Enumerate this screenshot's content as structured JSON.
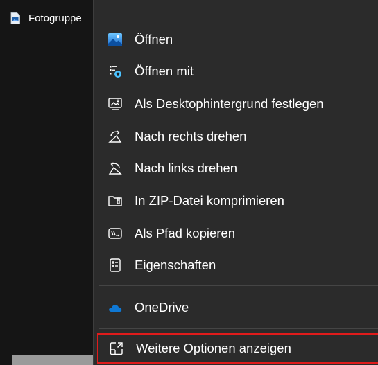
{
  "file": {
    "name": "Fotogruppe",
    "icon": "image-file-icon"
  },
  "menu": {
    "items": [
      {
        "label": "Öffnen",
        "icon": "photos-app-icon"
      },
      {
        "label": "Öffnen mit",
        "icon": "open-with-icon"
      },
      {
        "label": "Als Desktophintergrund festlegen",
        "icon": "desktop-background-icon"
      },
      {
        "label": "Nach rechts drehen",
        "icon": "rotate-right-icon"
      },
      {
        "label": "Nach links drehen",
        "icon": "rotate-left-icon"
      },
      {
        "label": "In ZIP-Datei komprimieren",
        "icon": "zip-folder-icon"
      },
      {
        "label": "Als Pfad kopieren",
        "icon": "copy-path-icon"
      },
      {
        "label": "Eigenschaften",
        "icon": "properties-icon"
      }
    ],
    "onedrive": {
      "label": "OneDrive",
      "icon": "onedrive-cloud-icon"
    },
    "more_options": {
      "label": "Weitere Optionen anzeigen",
      "icon": "more-options-icon",
      "highlight_color": "#e01b1b"
    }
  },
  "colors": {
    "menu_background": "#2b2b2b",
    "pane_background": "#151515",
    "accent": "#4cc2ff",
    "onedrive_blue": "#0f78d4"
  }
}
